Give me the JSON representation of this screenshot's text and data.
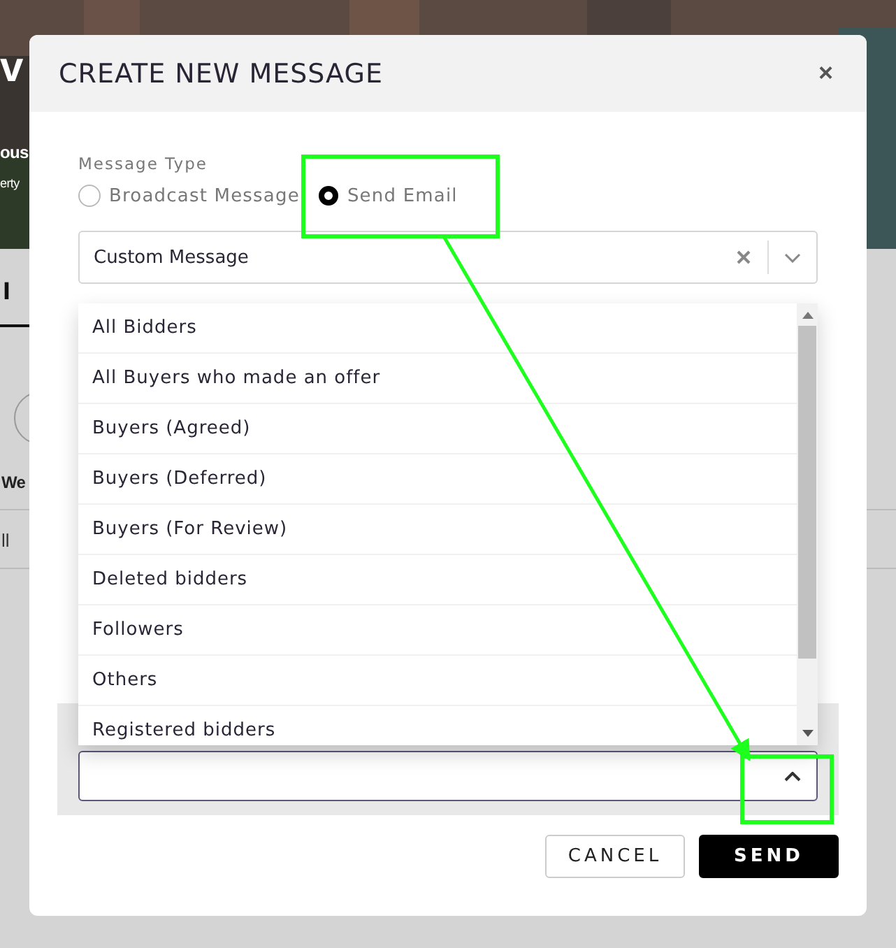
{
  "background": {
    "fragments": [
      {
        "kind": "hero_title",
        "text": "v"
      },
      {
        "kind": "hero_subtitle",
        "text": "ous"
      },
      {
        "kind": "hero_caption",
        "text": "erty"
      },
      {
        "kind": "tab",
        "text": "l"
      },
      {
        "kind": "heading",
        "text": "We"
      },
      {
        "kind": "link",
        "text": "ll"
      }
    ]
  },
  "dialog": {
    "title": "CREATE NEW MESSAGE",
    "close": "×",
    "message_type": {
      "label": "Message Type",
      "options": [
        {
          "label": "Broadcast Message",
          "selected": false
        },
        {
          "label": "Send Email",
          "selected": true
        }
      ]
    },
    "template_select": {
      "value": "Custom Message"
    },
    "recipient_select": {
      "expanded": true,
      "options": [
        {
          "label": "All Bidders"
        },
        {
          "label": "All Buyers who made an offer"
        },
        {
          "label": "Buyers (Agreed)"
        },
        {
          "label": "Buyers (Deferred)"
        },
        {
          "label": "Buyers (For Review)"
        },
        {
          "label": "Deleted bidders"
        },
        {
          "label": "Followers"
        },
        {
          "label": "Others"
        },
        {
          "label": "Registered bidders"
        }
      ]
    },
    "buttons": [
      {
        "label": "CANCEL",
        "kind": "secondary"
      },
      {
        "label": "SEND",
        "kind": "primary"
      }
    ]
  }
}
